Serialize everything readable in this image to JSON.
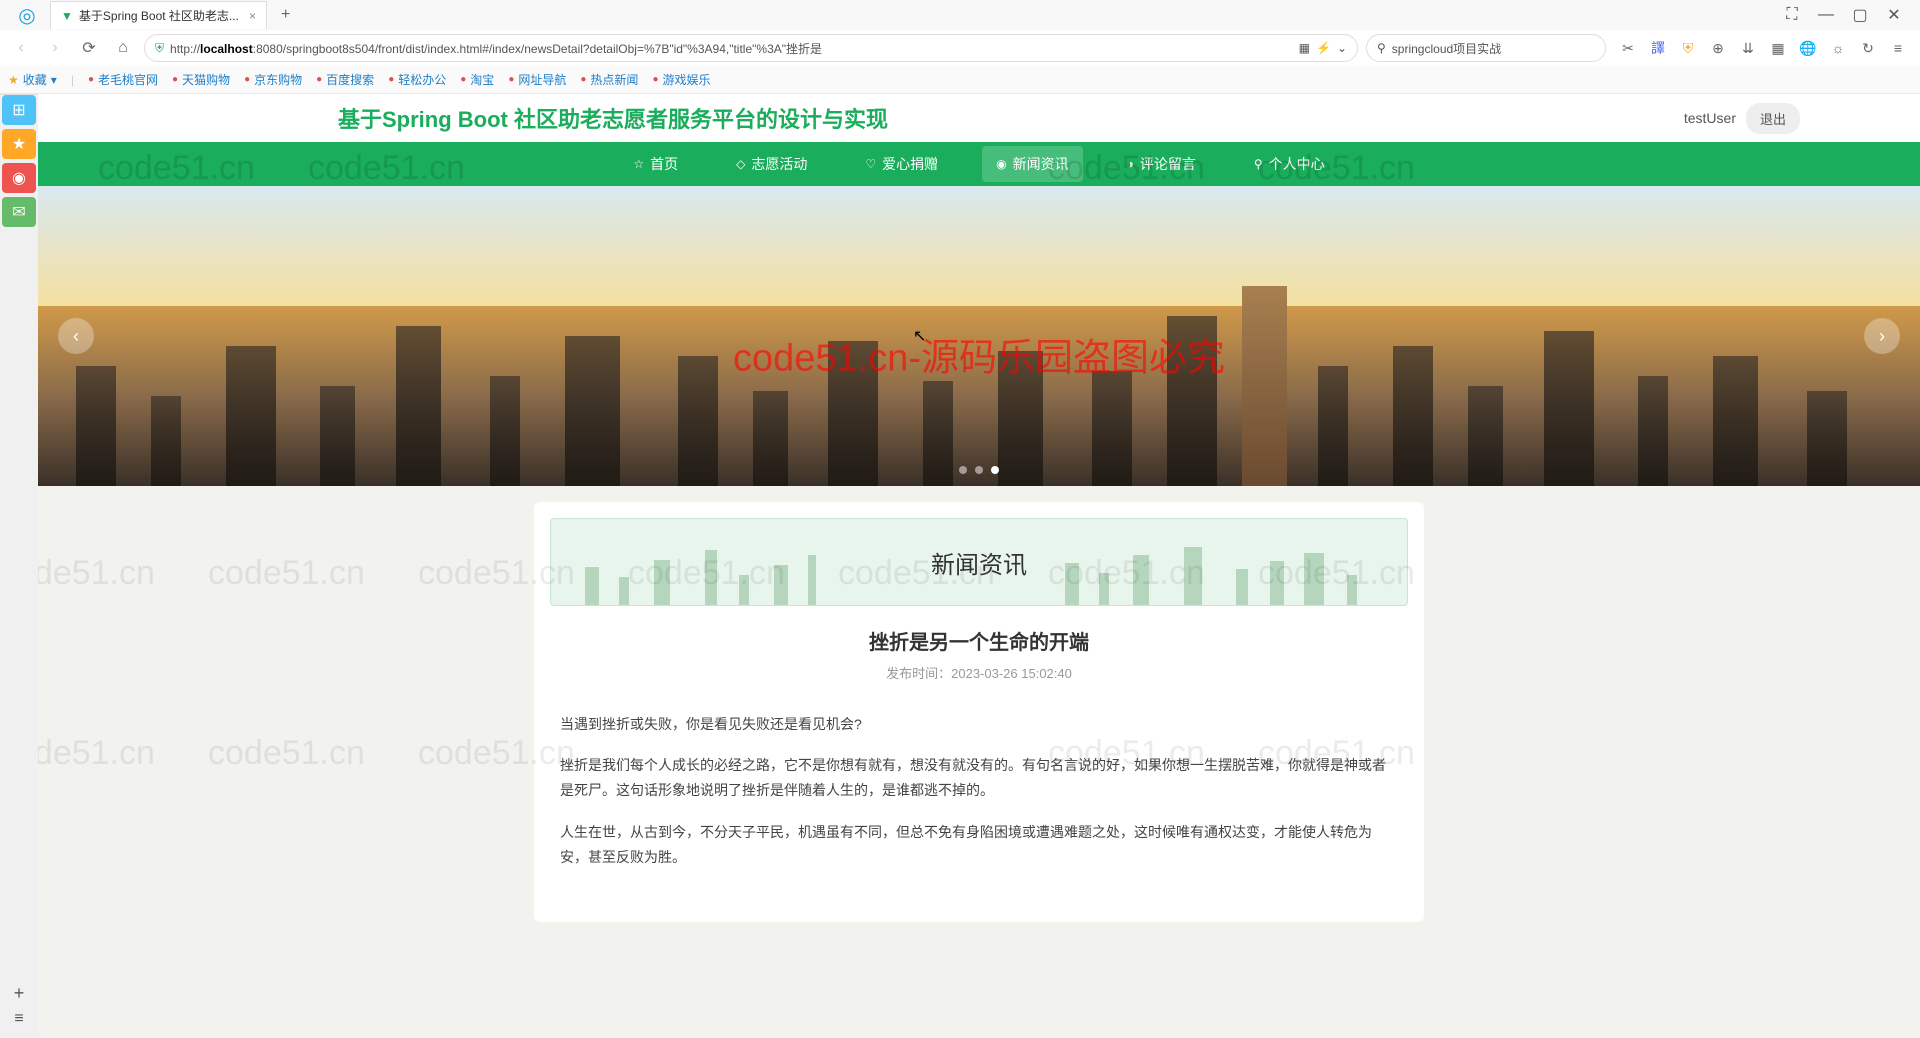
{
  "browser": {
    "tab_title": "基于Spring Boot 社区助老志...",
    "url_prefix": "http://",
    "url_host": "localhost",
    "url_rest": ":8080/springboot8s504/front/dist/index.html#/index/newsDetail?detailObj=%7B\"id\"%3A94,\"title\"%3A\"挫折是",
    "search_placeholder": "springcloud项目实战",
    "favorites_label": "收藏",
    "bookmarks": [
      "老毛桃官网",
      "天猫购物",
      "京东购物",
      "百度搜索",
      "轻松办公",
      "淘宝",
      "网址导航",
      "热点新闻",
      "游戏娱乐"
    ]
  },
  "site": {
    "title": "基于Spring Boot 社区助老志愿者服务平台的设计与实现",
    "username": "testUser",
    "logout": "退出",
    "nav": [
      {
        "label": "首页",
        "icon": "☆"
      },
      {
        "label": "志愿活动",
        "icon": "◇"
      },
      {
        "label": "爱心捐赠",
        "icon": "♡"
      },
      {
        "label": "新闻资讯",
        "icon": "◉",
        "active": true
      },
      {
        "label": "评论留言",
        "icon": "◑"
      },
      {
        "label": "个人中心",
        "icon": "⚲"
      }
    ]
  },
  "banner": {
    "watermark": "code51.cn-源码乐园盗图必究",
    "dots": 3,
    "active_dot": 2
  },
  "section": {
    "title": "新闻资讯"
  },
  "article": {
    "title": "挫折是另一个生命的开端",
    "meta_label": "发布时间：",
    "meta_time": "2023-03-26 15:02:40",
    "paragraphs": [
      "当遇到挫折或失败，你是看见失败还是看见机会?",
      "挫折是我们每个人成长的必经之路，它不是你想有就有，想没有就没有的。有句名言说的好，如果你想一生摆脱苦难，你就得是神或者是死尸。这句话形象地说明了挫折是伴随着人生的，是谁都逃不掉的。",
      "人生在世，从古到今，不分天子平民，机遇虽有不同，但总不免有身陷困境或遭遇难题之处，这时候唯有通权达变，才能使人转危为安，甚至反败为胜。"
    ]
  },
  "watermarks": [
    "code51.cn",
    "code51.cn",
    "code51.cn",
    "code51.cn",
    "code51.cn",
    "code51.cn",
    "code51.cn"
  ]
}
